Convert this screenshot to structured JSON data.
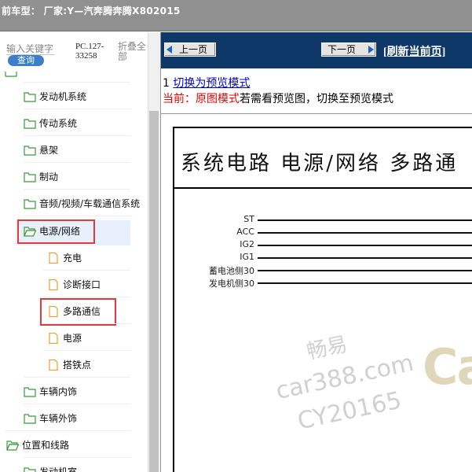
{
  "titlebar": {
    "text": "前车型：  厂家:Y—汽奔腾奔腾X802015"
  },
  "left": {
    "search_placeholder": "输入关键字",
    "query_button": "查询",
    "pc_text": "PC.127-33258",
    "fold_all": "折叠全部"
  },
  "tree": [
    {
      "label": "发动机系统"
    },
    {
      "label": "传动系统"
    },
    {
      "label": "悬架"
    },
    {
      "label": "制动"
    },
    {
      "label": "音频/视频/车载通信系统"
    },
    {
      "label": "电源/网络"
    },
    {
      "label": "充电"
    },
    {
      "label": "诊断接口"
    },
    {
      "label": "多路通信"
    },
    {
      "label": "电源"
    },
    {
      "label": "搭铁点"
    },
    {
      "label": "车辆内饰"
    },
    {
      "label": "车辆外饰"
    },
    {
      "label": "位置和线路"
    },
    {
      "label": "发动机室"
    }
  ],
  "nav": {
    "prev": "上一页",
    "next": "下一页",
    "refresh": "[刷新当前页]"
  },
  "content": {
    "line1_num": "1",
    "line1_link": "切换为预览模式",
    "line2_current": "当前：原图模式",
    "line2_rest": "若需看预览图，切换至预览模式",
    "diagram_title": "系统电路  电源/网络  多路通",
    "signals": [
      "ST",
      "ACC",
      "IG2",
      "IG1",
      "蓄电池侧30",
      "发电机侧30"
    ]
  },
  "watermark": {
    "line1": "畅易",
    "line2": "car388.com",
    "line3": "CY20165",
    "logo": "Ca"
  },
  "colors": {
    "navbar": "#0e3868",
    "accent_red": "#e0393e",
    "link_blue": "#0000cc",
    "query_button": "#3d7fc8"
  }
}
